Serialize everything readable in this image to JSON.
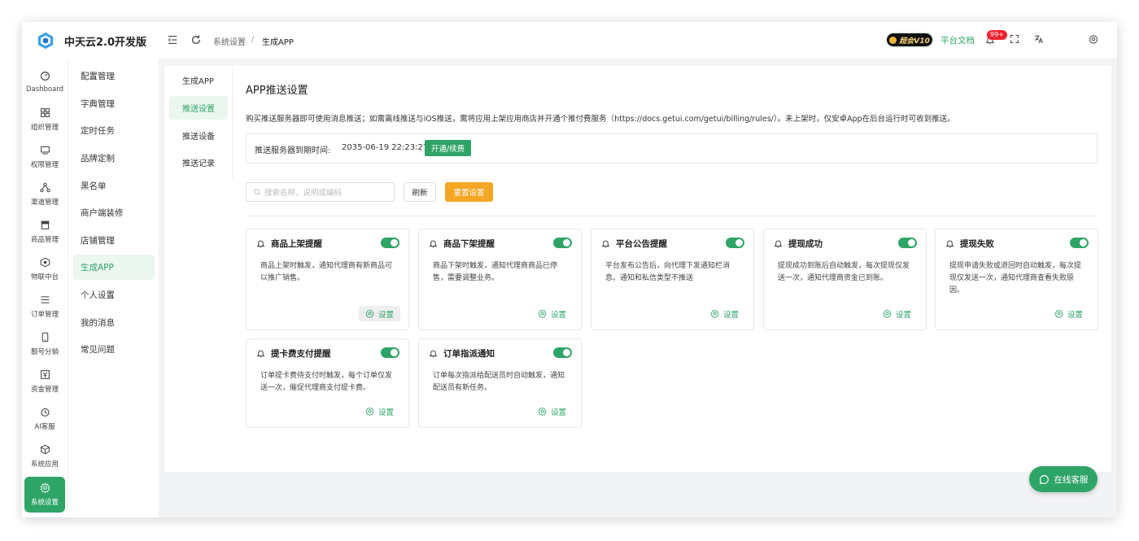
{
  "brand": {
    "name": "中天云2.0开发版",
    "accent": "#2fa467"
  },
  "rail": [
    {
      "label": "Dashboard",
      "icon": "dashboard-icon"
    },
    {
      "label": "组织管理",
      "icon": "grid-icon"
    },
    {
      "label": "权限管理",
      "icon": "monitor-icon"
    },
    {
      "label": "渠道管理",
      "icon": "network-icon"
    },
    {
      "label": "商品管理",
      "icon": "store-icon"
    },
    {
      "label": "物联中台",
      "icon": "iot-icon"
    },
    {
      "label": "订单管理",
      "icon": "list-icon"
    },
    {
      "label": "靓号分销",
      "icon": "phone-icon"
    },
    {
      "label": "资金管理",
      "icon": "yuan-icon"
    },
    {
      "label": "AI客服",
      "icon": "ai-icon"
    },
    {
      "label": "系统应用",
      "icon": "cube-icon"
    },
    {
      "label": "系统设置",
      "icon": "gear-icon",
      "active": true
    }
  ],
  "submenu": [
    "配置管理",
    "字典管理",
    "定时任务",
    "品牌定制",
    "黑名单",
    "商户端装修",
    "店铺管理",
    "生成APP",
    "个人设置",
    "我的消息",
    "常见问题"
  ],
  "submenu_active": "生成APP",
  "topbar": {
    "breadcrumb": [
      "系统设置",
      "生成APP"
    ],
    "separator": "/",
    "vip_label": "超会V10",
    "doc_link": "平台文档",
    "notif_badge": "99+"
  },
  "inner_nav": [
    "生成APP",
    "推送设置",
    "推送设备",
    "推送记录"
  ],
  "inner_active": "推送设置",
  "section": {
    "title": "APP推送设置",
    "description": "购买推送服务器即可使用消息推送；如需离线推送与iOS推送，需将应用上架应用商店并开通个推付费服务（https://docs.getui.com/getui/billing/rules/）。未上架时，仅安卓App在后台运行时可收到推送。",
    "expire_label": "推送服务器到期时间:",
    "expire_date": "2035-06-19 22:23:27",
    "expire_button": "开通/续费"
  },
  "search": {
    "placeholder": "搜索名称、说明或编码"
  },
  "buttons": {
    "refresh": "刷新",
    "reset": "重置设置"
  },
  "cards": [
    {
      "title": "商品上架提醒",
      "desc": "商品上架时触发，通知代理商有新商品可以推广销售。",
      "enabled": true,
      "action": "设置"
    },
    {
      "title": "商品下架提醒",
      "desc": "商品下架时触发，通知代理商商品已停售，需要调整业务。",
      "enabled": true,
      "action": "设置"
    },
    {
      "title": "平台公告提醒",
      "desc": "平台发布公告后，向代理下发通知栏消息。通知和私信类型不推送",
      "enabled": true,
      "action": "设置"
    },
    {
      "title": "提现成功",
      "desc": "提现成功到账后自动触发，每次提现仅发送一次，通知代理商资金已到账。",
      "enabled": true,
      "action": "设置"
    },
    {
      "title": "提现失败",
      "desc": "提现申请失败或退回时自动触发，每次提现仅发送一次，通知代理商查看失败原因。",
      "enabled": true,
      "action": "设置"
    },
    {
      "title": "提卡费支付提醒",
      "desc": "订单提卡费待支付时触发，每个订单仅发送一次，催促代理商支付提卡费。",
      "enabled": true,
      "action": "设置"
    },
    {
      "title": "订单指派通知",
      "desc": "订单每次指派给配送员时自动触发，通知配送员有新任务。",
      "enabled": true,
      "action": "设置"
    }
  ],
  "chat": {
    "label": "在线客服"
  }
}
